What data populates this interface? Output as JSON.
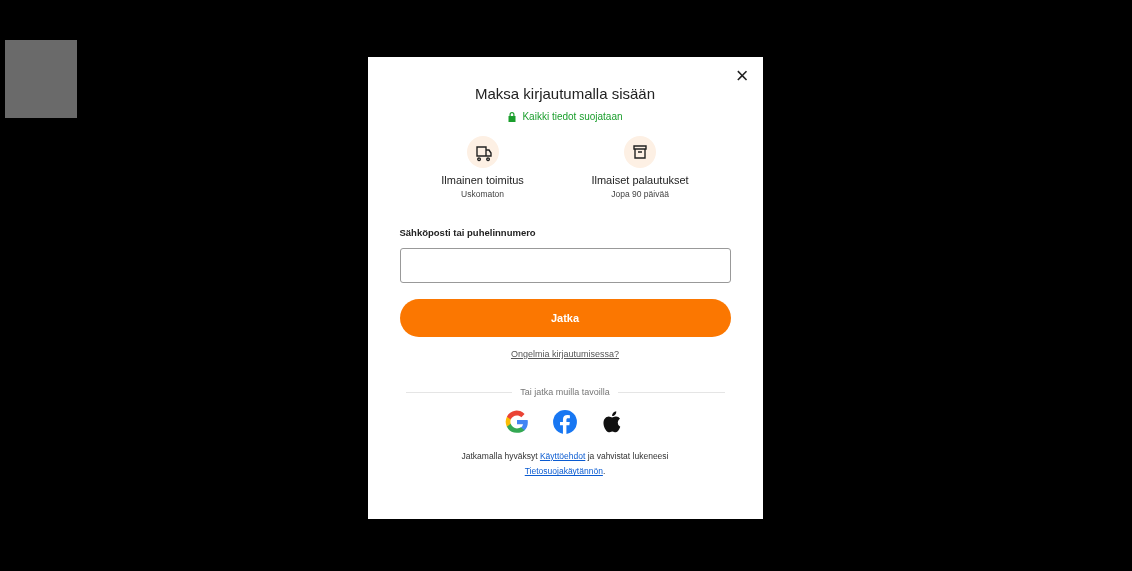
{
  "dialog": {
    "close": "×",
    "title": "Maksa kirjautumalla sisään",
    "secure_note": "Kaikki tiedot suojataan",
    "benefits": [
      {
        "kind": "truck",
        "title": "Ilmainen toimitus",
        "subtitle": "Uskomaton"
      },
      {
        "kind": "box",
        "title": "Ilmaiset palautukset",
        "subtitle": "Jopa 90 päivää"
      }
    ],
    "field_label": "Sähköposti tai puhelinnumero",
    "continue_button": "Jatka",
    "help_link": "Ongelmia kirjautumisessa?",
    "divider_text": "Tai jatka muilla tavoilla",
    "providers": [
      {
        "kind": "google"
      },
      {
        "kind": "facebook"
      },
      {
        "kind": "apple"
      }
    ],
    "terms": {
      "before": "Jatkamalla hyväksyt",
      "terms_link": "Käyttöehdot",
      "middle": "ja vahvistat lukeneesi",
      "privacy_link": "Tietosuojakäytännön",
      "after": "."
    }
  }
}
